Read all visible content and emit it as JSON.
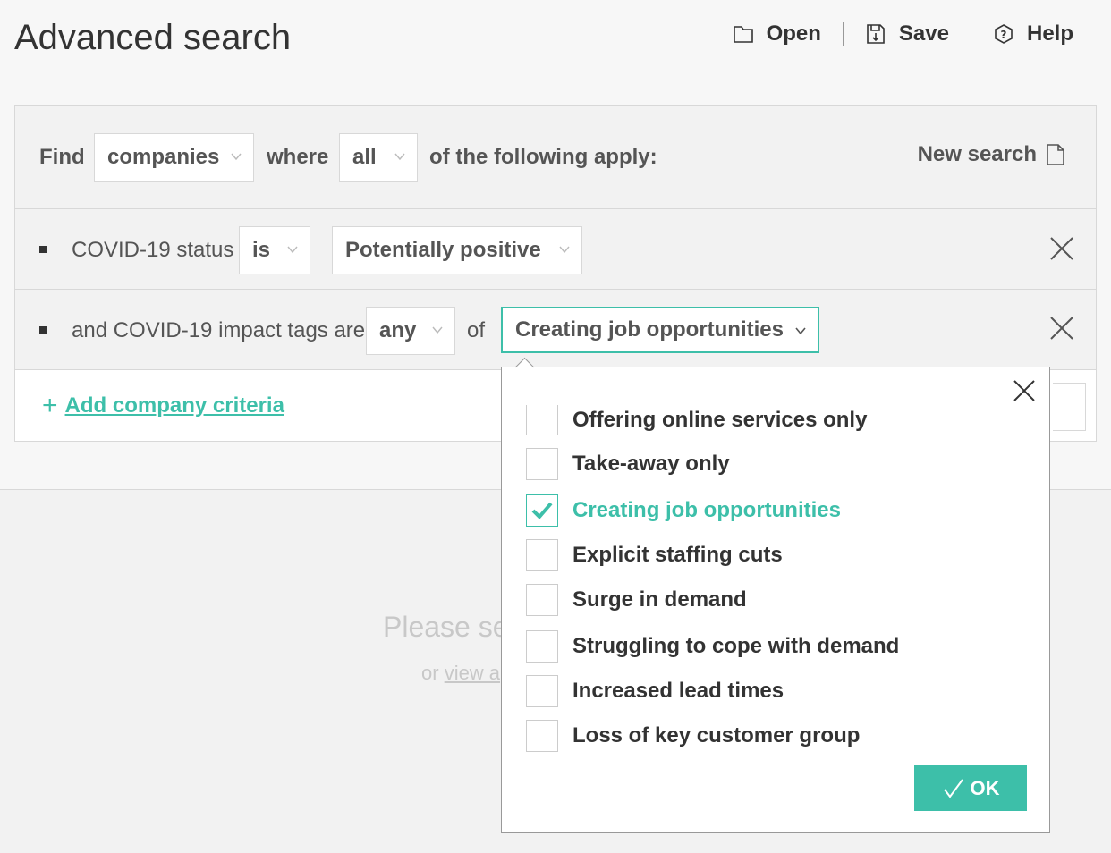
{
  "header": {
    "title": "Advanced search"
  },
  "toolbar": {
    "open_label": "Open",
    "save_label": "Save",
    "help_label": "Help"
  },
  "find_row": {
    "find_label": "Find",
    "entity_value": "companies",
    "where_label": "where",
    "match_value": "all",
    "suffix_label": "of the following apply:",
    "new_search_label": "New search"
  },
  "criteria": [
    {
      "field_label": "COVID-19 status",
      "operator_value": "is",
      "value": "Potentially positive"
    },
    {
      "field_label": "and COVID-19 impact tags are",
      "operator_value": "any",
      "of_label": "of",
      "value": "Creating job opportunities"
    }
  ],
  "add_criteria_label": "Add company criteria",
  "placeholder": {
    "main": "Please se",
    "sub_prefix": "or",
    "sub_link": "view a"
  },
  "popup": {
    "options": [
      {
        "label": "Offering online services only",
        "checked": false
      },
      {
        "label": "Take-away only",
        "checked": false
      },
      {
        "label": "Creating job opportunities",
        "checked": true
      },
      {
        "label": "Explicit staffing cuts",
        "checked": false
      },
      {
        "label": "Surge in demand",
        "checked": false
      },
      {
        "label": "Struggling to cope with demand",
        "checked": false
      },
      {
        "label": "Increased lead times",
        "checked": false
      },
      {
        "label": "Loss of key customer group",
        "checked": false
      }
    ],
    "ok_label": "OK"
  },
  "colors": {
    "accent": "#3dbfa9",
    "text": "#333333",
    "muted": "#c8c8c8",
    "panel": "#f2f2f2"
  }
}
